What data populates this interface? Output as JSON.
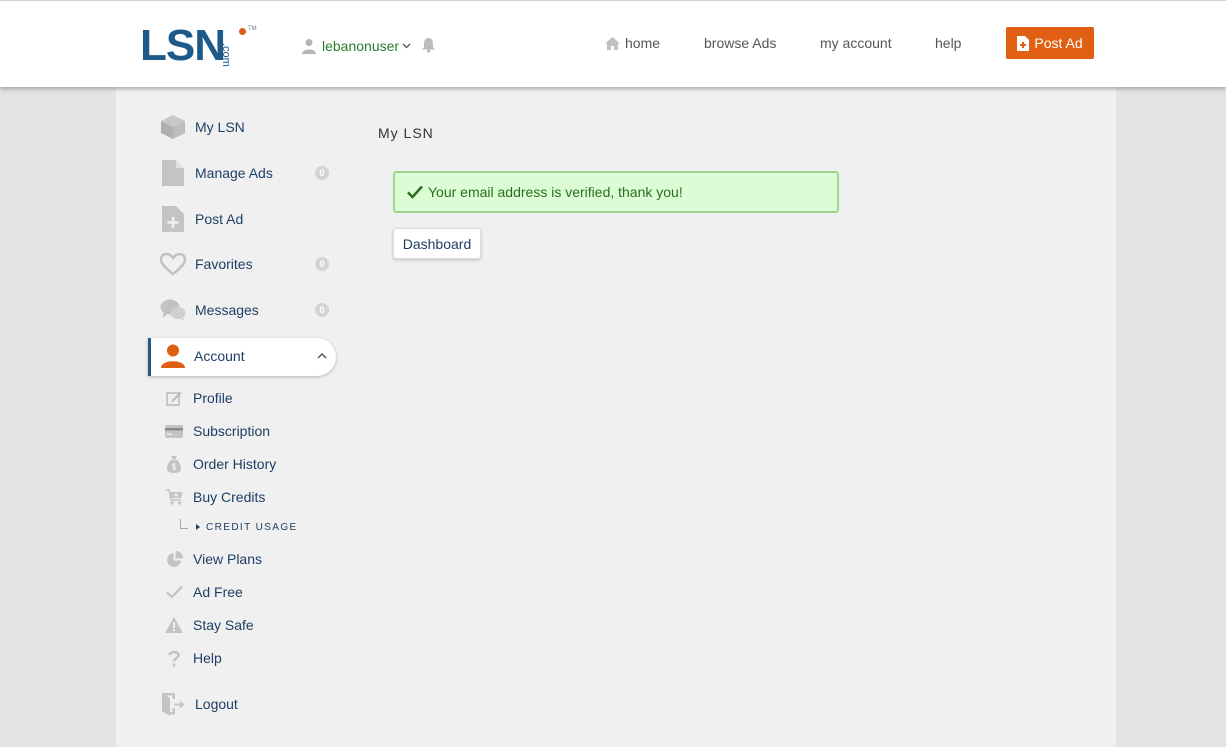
{
  "header": {
    "logo": {
      "main": "LSN",
      "suffix": ".com",
      "tm": "TM"
    },
    "username": "lebanonuser",
    "nav": {
      "home": "home",
      "browse": "browse Ads",
      "account": "my account",
      "help": "help"
    },
    "post_ad": "Post Ad"
  },
  "sidebar": {
    "items": [
      {
        "label": "My LSN",
        "icon": "box-icon"
      },
      {
        "label": "Manage Ads",
        "icon": "document-icon",
        "badge": "0"
      },
      {
        "label": "Post Ad",
        "icon": "document-plus-icon"
      },
      {
        "label": "Favorites",
        "icon": "heart-icon",
        "badge": "0"
      },
      {
        "label": "Messages",
        "icon": "chat-icon",
        "badge": "0"
      }
    ],
    "account": {
      "label": "Account",
      "expanded": true
    },
    "sub_items": [
      {
        "label": "Profile",
        "icon": "edit-icon"
      },
      {
        "label": "Subscription",
        "icon": "card-icon"
      },
      {
        "label": "Order History",
        "icon": "money-bag-icon"
      },
      {
        "label": "Buy Credits",
        "icon": "cart-icon"
      }
    ],
    "credit_usage": "CREDIT USAGE",
    "sub_items_2": [
      {
        "label": "View Plans",
        "icon": "pie-chart-icon"
      },
      {
        "label": "Ad Free",
        "icon": "check-icon"
      },
      {
        "label": "Stay Safe",
        "icon": "warning-icon"
      },
      {
        "label": "Help",
        "icon": "question-icon"
      }
    ],
    "logout": "Logout"
  },
  "main": {
    "title": "My LSN",
    "alert": "Your email address is verified, thank you!",
    "dashboard_button": "Dashboard"
  },
  "colors": {
    "brand": "#1d5a8a",
    "accent": "#e05f12",
    "success_bg": "#dcfcd6",
    "success_text": "#2a6e1f",
    "username": "#2a7a2a"
  }
}
